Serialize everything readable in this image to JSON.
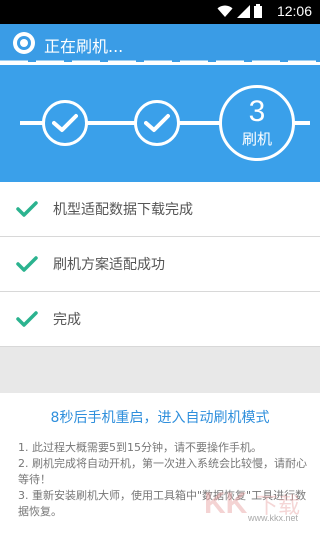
{
  "status_bar": {
    "time": "12:06",
    "icons": [
      "wifi-icon",
      "signal-icon",
      "battery-icon"
    ]
  },
  "title_bar": {
    "title": "正在刷机..."
  },
  "steps": {
    "current_number": "3",
    "current_label": "刷机",
    "completed_steps": 2
  },
  "tasks": [
    {
      "label": "机型适配数据下载完成",
      "status": "done"
    },
    {
      "label": "刷机方案适配成功",
      "status": "done"
    },
    {
      "label": "完成",
      "status": "done"
    }
  ],
  "countdown_text": "8秒后手机重启，进入自动刷机模式",
  "notes": [
    "1. 此过程大概需要5到15分钟，请不要操作手机。",
    "2. 刷机完成将自动开机，第一次进入系统会比较慢，请耐心等待！",
    "3. 重新安装刷机大师，使用工具箱中\"数据恢复\"工具进行数据恢复。"
  ],
  "watermark_text": "www.kkx.net",
  "colors": {
    "accent_blue": "#3aa0ea",
    "check_green": "#2bb38f",
    "countdown_blue": "#2f8fdc"
  }
}
